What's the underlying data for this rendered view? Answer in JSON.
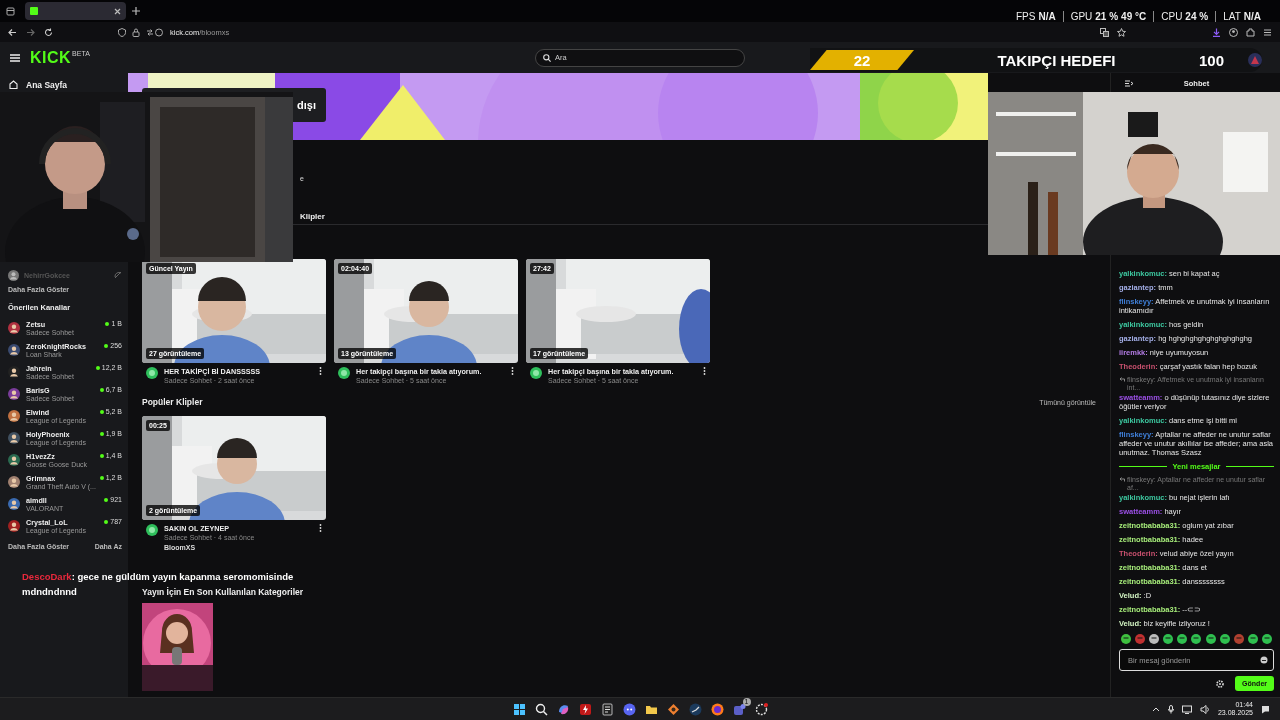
{
  "browser": {
    "url_host": "kick.com",
    "url_path": "/bloomxs"
  },
  "perf_overlay": [
    {
      "label": "FPS",
      "values": [
        "N/A"
      ]
    },
    {
      "label": "GPU",
      "values": [
        "21 %",
        "49 °C"
      ]
    },
    {
      "label": "CPU",
      "values": [
        "24 %"
      ]
    },
    {
      "label": "LAT",
      "values": [
        "N/A"
      ]
    }
  ],
  "header": {
    "logo": "KICK",
    "logo_tag": "BETA",
    "search": {
      "placeholder": "Ara"
    }
  },
  "follower_goal": {
    "count": "22",
    "title": "TAKIPÇI HEDEFI",
    "target": "100"
  },
  "sidebar": {
    "home": "Ana Sayfa",
    "followed": [
      {
        "name": "NehirrGokcee",
        "offline": true
      }
    ],
    "show_more_followed": "Daha Fazla Göster",
    "recommended_title": "Önerilen Kanallar",
    "channels": [
      {
        "name": "Zetsu",
        "category": "Sadece Sohbet",
        "viewers": "1 B"
      },
      {
        "name": "ZeroKnightRocks",
        "category": "Loan Shark",
        "viewers": "256"
      },
      {
        "name": "Jahrein",
        "category": "Sadece Sohbet",
        "viewers": "12,2 B"
      },
      {
        "name": "BarisG",
        "category": "Sadece Sohbet",
        "viewers": "6,7 B"
      },
      {
        "name": "Elwind",
        "category": "League of Legends",
        "viewers": "5,2 B"
      },
      {
        "name": "HolyPhoenix",
        "category": "League of Legends",
        "viewers": "1,9 B"
      },
      {
        "name": "H1vezZz",
        "category": "Goose Goose Duck",
        "viewers": "1,4 B"
      },
      {
        "name": "Grimnax",
        "category": "Grand Theft Auto V (...",
        "viewers": "1,2 B"
      },
      {
        "name": "aimdll",
        "category": "VALORANT",
        "viewers": "921"
      },
      {
        "name": "Crystal_LoL",
        "category": "League of Legends",
        "viewers": "787"
      }
    ],
    "show_more": "Daha Fazla Göster",
    "show_less": "Daha Az"
  },
  "banner_tooltip": "dışı",
  "cut_text": "e",
  "tabs": [
    {
      "label": "Klipler",
      "selected": false
    }
  ],
  "clips": [
    {
      "badge": "Güncel Yayın",
      "views": "27 görüntüleme",
      "title": "HER TAKİPÇİ Bİ DANSSSSS",
      "meta": "Sadece Sohbet · 2 saat önce"
    },
    {
      "badge": "02:04:40",
      "views": "13 görüntüleme",
      "title": "Her takipçi başına bir takla atıyorum.",
      "meta": "Sadece Sohbet · 5 saat önce"
    },
    {
      "badge": "27:42",
      "views": "17 görüntüleme",
      "title": "Her takipçi başına bir takla atıyorum.",
      "meta": "Sadece Sohbet · 5 saat önce"
    }
  ],
  "popular": {
    "title": "Popüler Klipler",
    "view_all": "Tümünü görüntüle",
    "clips": [
      {
        "badge": "00:25",
        "views": "2 görüntüleme",
        "title": "SAKIN OL ZEYNEP",
        "meta": "Sadece Sohbet · 4 saat önce",
        "author": "BloomXS"
      }
    ]
  },
  "categories": {
    "title": "Yayın İçin En Son Kullanılan Kategoriler"
  },
  "stream_chat_overlay": {
    "user": "DescoDark",
    "color": "#e8283c",
    "lines": [
      ": gece ne güldüm yayın kapanma seromomisinde",
      "mdndndnnd"
    ]
  },
  "chat": {
    "title": "Sohbet",
    "messages": [
      {
        "kind": "message",
        "user": "yalkinkomuc:",
        "color": "#3dc8a0",
        "text": "sen bi kapat aç"
      },
      {
        "kind": "message",
        "user": "gaziantep:",
        "color": "#a3aee6",
        "text": "tmm"
      },
      {
        "kind": "message",
        "user": "flinskeyy:",
        "color": "#3f7fd8",
        "text": "Affetmek ve unutmak iyi insanların intikamıdır"
      },
      {
        "kind": "message",
        "user": "yalkinkomuc:",
        "color": "#3dc8a0",
        "text": "hos geldin"
      },
      {
        "kind": "message",
        "user": "gaziantep:",
        "color": "#a3aee6",
        "text": "hg hghghghghghghghghghg"
      },
      {
        "kind": "message",
        "user": "iiremkk:",
        "color": "#b47ce6",
        "text": "niye uyumuyosun"
      },
      {
        "kind": "message",
        "user": "Theoderin:",
        "color": "#c8506e",
        "text": "çarşaf yastık falan hep bozuk"
      },
      {
        "kind": "reply",
        "text": "flinskeyy: Affetmek ve unutmak iyi insanların int..."
      },
      {
        "kind": "message",
        "user": "swatteamm:",
        "color": "#9b4fe6",
        "text": "o düşünüp tutasınız diye sizlere öğütler veriyor"
      },
      {
        "kind": "message",
        "user": "yalkinkomuc:",
        "color": "#3dc8a0",
        "text": "dans etme işi bitti mi"
      },
      {
        "kind": "message",
        "user": "flinskeyy:",
        "color": "#3f7fd8",
        "text": "Aptallar ne affeder ne unutur saflar affeder ve unutur akıllılar ise affeder; ama asla unutmaz. Thomas Szasz"
      },
      {
        "kind": "divider",
        "text": "Yeni mesajlar"
      },
      {
        "kind": "reply",
        "text": "flinskeyy: Aptallar ne affeder ne unutur saflar af..."
      },
      {
        "kind": "message",
        "user": "yalkinkomuc:",
        "color": "#3dc8a0",
        "text": "bu nejat işlerin lafı"
      },
      {
        "kind": "message",
        "user": "swatteamm:",
        "color": "#9b4fe6",
        "text": "hayır"
      },
      {
        "kind": "message",
        "user": "zeitnotbababa31:",
        "color": "#a6ec7a",
        "text": "oglum yat zıbar"
      },
      {
        "kind": "message",
        "user": "zeitnotbababa31:",
        "color": "#a6ec7a",
        "text": "hadee"
      },
      {
        "kind": "message",
        "user": "Theoderin:",
        "color": "#c8506e",
        "text": "velud abiye özel yayın"
      },
      {
        "kind": "message",
        "user": "zeitnotbababa31:",
        "color": "#a6ec7a",
        "text": "dans et"
      },
      {
        "kind": "message",
        "user": "zeitnotbababa31:",
        "color": "#a6ec7a",
        "text": "danssssssss"
      },
      {
        "kind": "message",
        "user": "Velud:",
        "color": "#d4f5c4",
        "text": ":D"
      },
      {
        "kind": "message",
        "user": "zeitnotbababa31:",
        "color": "#a6ec7a",
        "text": "--⊂⊃"
      },
      {
        "kind": "message",
        "user": "Velud:",
        "color": "#d4f5c4",
        "text": "biz keyifle izliyoruz !"
      }
    ],
    "input": {
      "placeholder": "Bir mesaj gönderin"
    },
    "send": "Gönder"
  },
  "taskbar": {
    "badge": "1",
    "time": "01:44",
    "date": "23.08.2025"
  }
}
